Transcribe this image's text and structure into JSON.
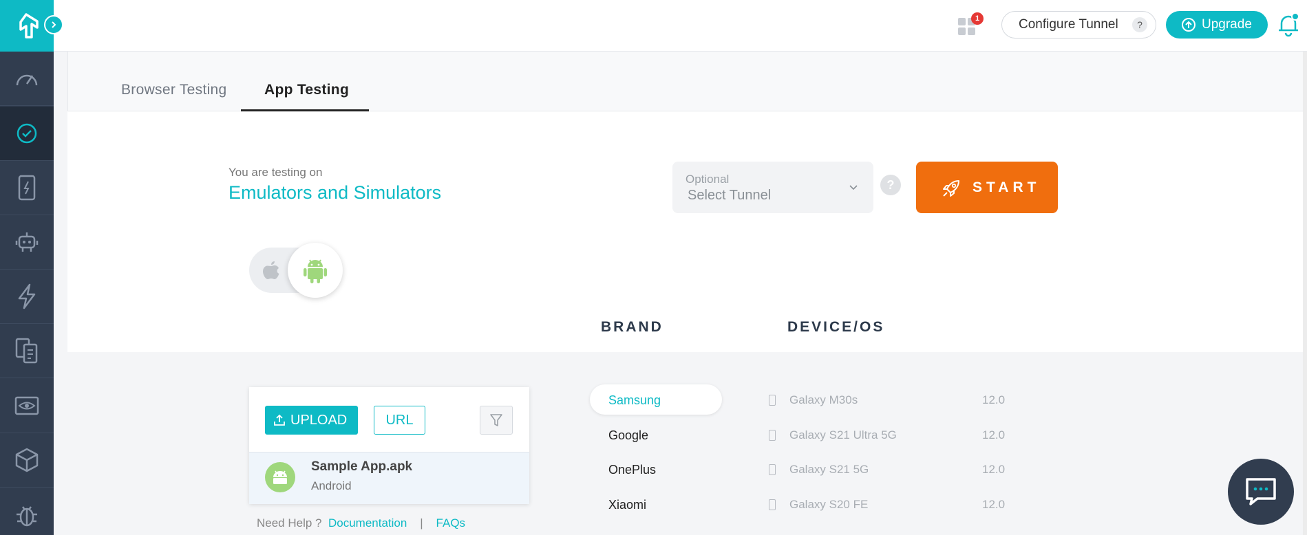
{
  "header": {
    "apps_badge_count": "1",
    "configure_tunnel_label": "Configure Tunnel",
    "tunnel_help": "?",
    "upgrade_label": "Upgrade"
  },
  "sidebar": {
    "items": [
      {
        "name": "dashboard",
        "icon": "speedometer-icon"
      },
      {
        "name": "realtime",
        "icon": "clock-check-icon",
        "active": true
      },
      {
        "name": "devices",
        "icon": "phone-bolt-icon"
      },
      {
        "name": "automation",
        "icon": "robot-icon"
      },
      {
        "name": "hyperexecute",
        "icon": "lightning-icon"
      },
      {
        "name": "test-manager",
        "icon": "documents-icon"
      },
      {
        "name": "visual",
        "icon": "eye-icon"
      },
      {
        "name": "integrations",
        "icon": "box-icon"
      },
      {
        "name": "issues",
        "icon": "bug-icon"
      }
    ]
  },
  "tabs": [
    {
      "label": "Browser Testing",
      "active": false
    },
    {
      "label": "App Testing",
      "active": true
    }
  ],
  "target": {
    "caption": "You are testing on",
    "title": "Emulators and Simulators"
  },
  "tunnel_select": {
    "caption": "Optional",
    "placeholder": "Select Tunnel",
    "help": "?"
  },
  "start_label": "START",
  "columns": {
    "brand": "BRAND",
    "device": "DEVICE/OS"
  },
  "app_panel": {
    "upload_label": "UPLOAD",
    "url_label": "URL",
    "app": {
      "name": "Sample App.apk",
      "platform": "Android"
    }
  },
  "help": {
    "prefix": "Need Help ?",
    "documentation": "Documentation",
    "separator": "|",
    "faqs": "FAQs"
  },
  "brands": [
    "Samsung",
    "Google",
    "OnePlus",
    "Xiaomi"
  ],
  "active_brand": "Samsung",
  "devices": [
    {
      "name": "Galaxy M30s",
      "os": "12.0"
    },
    {
      "name": "Galaxy S21 Ultra 5G",
      "os": "12.0"
    },
    {
      "name": "Galaxy S21 5G",
      "os": "12.0"
    },
    {
      "name": "Galaxy S20 FE",
      "os": "12.0"
    }
  ],
  "colors": {
    "accent": "#0ebac5",
    "sidebar": "#313d4f",
    "start": "#f06e0e",
    "android": "#9fd77c"
  }
}
